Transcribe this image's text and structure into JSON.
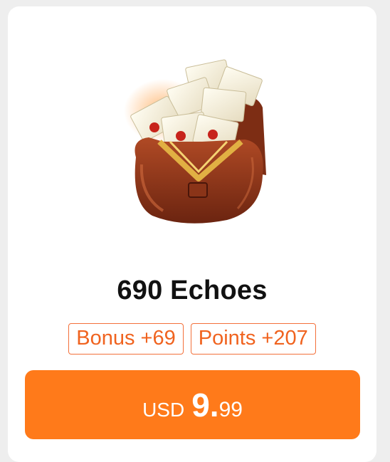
{
  "product": {
    "icon": "mail-bag-icon",
    "name": "690 Echoes",
    "badges": [
      {
        "label": "Bonus +69"
      },
      {
        "label": "Points +207"
      }
    ]
  },
  "price": {
    "currency": "USD",
    "main": "9.",
    "cents": "99"
  },
  "colors": {
    "accent": "#ff7a1a",
    "badge_text": "#f0631f",
    "badge_border": "#f3703a"
  }
}
